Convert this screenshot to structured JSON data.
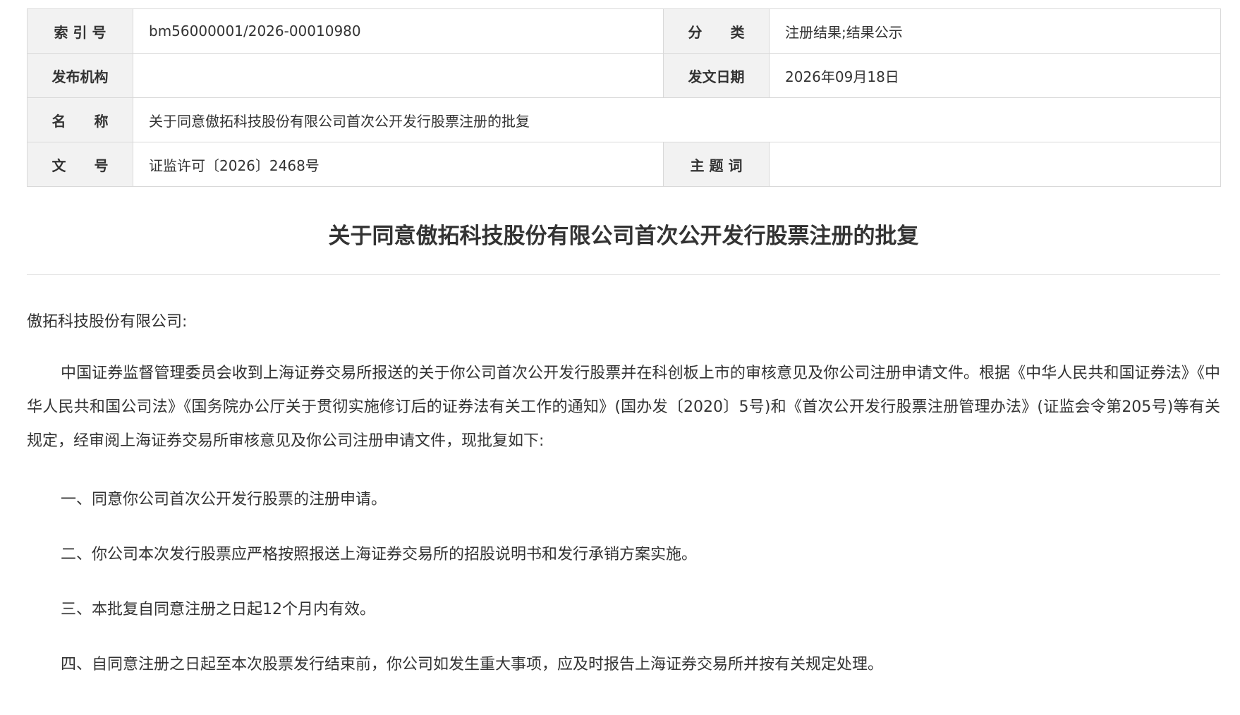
{
  "meta_table": {
    "index_label": "索 引 号",
    "index_value": "bm56000001/2026-00010980",
    "category_label": "分　　类",
    "category_value": "注册结果;结果公示",
    "publisher_label": "发布机构",
    "publisher_value": "",
    "date_label": "发文日期",
    "date_value": "2026年09月18日",
    "name_label": "名　　称",
    "name_value": "关于同意傲拓科技股份有限公司首次公开发行股票注册的批复",
    "docno_label": "文　　号",
    "docno_value": "证监许可〔2026〕2468号",
    "keywords_label": "主 题 词",
    "keywords_value": ""
  },
  "document": {
    "title": "关于同意傲拓科技股份有限公司首次公开发行股票注册的批复",
    "addressee": "傲拓科技股份有限公司:",
    "paragraph": "中国证券监督管理委员会收到上海证券交易所报送的关于你公司首次公开发行股票并在科创板上市的审核意见及你公司注册申请文件。根据《中华人民共和国证券法》《中华人民共和国公司法》《国务院办公厅关于贯彻实施修订后的证券法有关工作的通知》(国办发〔2020〕5号)和《首次公开发行股票注册管理办法》(证监会令第205号)等有关规定，经审阅上海证券交易所审核意见及你公司注册申请文件，现批复如下:",
    "items": [
      "一、同意你公司首次公开发行股票的注册申请。",
      "二、你公司本次发行股票应严格按照报送上海证券交易所的招股说明书和发行承销方案实施。",
      "三、本批复自同意注册之日起12个月内有效。",
      "四、自同意注册之日起至本次股票发行结束前，你公司如发生重大事项，应及时报告上海证券交易所并按有关规定处理。"
    ]
  }
}
